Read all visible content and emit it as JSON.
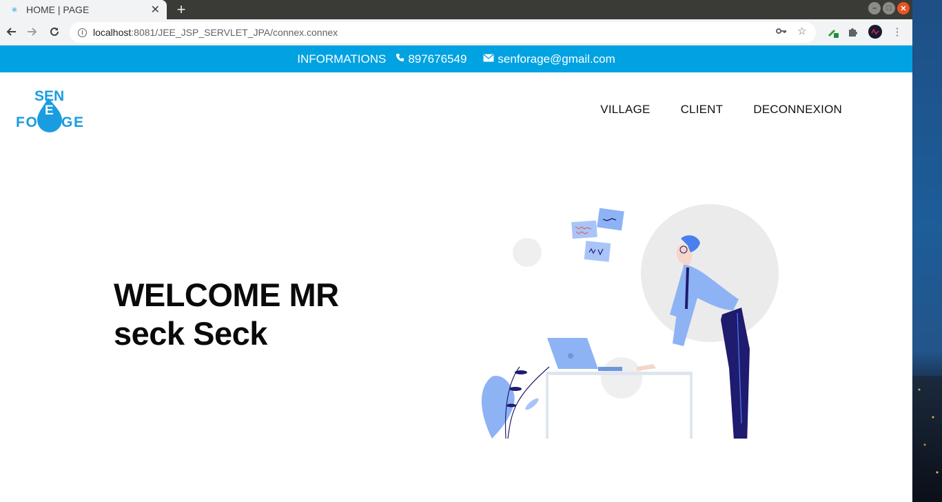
{
  "browser": {
    "tab_title": "HOME | PAGE",
    "tab_close": "✕",
    "new_tab": "+",
    "url_host": "localhost",
    "url_path": ":8081/JEE_JSP_SERVLET_JPA/connex.connex"
  },
  "info_bar": {
    "label": "INFORMATIONS",
    "phone": "897676549",
    "email": "senforage@gmail.com"
  },
  "logo": {
    "text_top": "SEN",
    "text_mid": "E",
    "text_bottom": "FORAGE"
  },
  "nav": {
    "items": [
      "VILLAGE",
      "CLIENT",
      "DECONNEXION"
    ]
  },
  "hero": {
    "line1": "WELCOME MR",
    "line2": "seck Seck"
  },
  "colors": {
    "accent": "#00a2e2",
    "illustration_blue": "#8db3f5",
    "illustration_navy": "#1f1b6e",
    "illustration_red": "#f0363c"
  },
  "icons": {
    "phone": "phone-icon",
    "email": "envelope-icon"
  }
}
